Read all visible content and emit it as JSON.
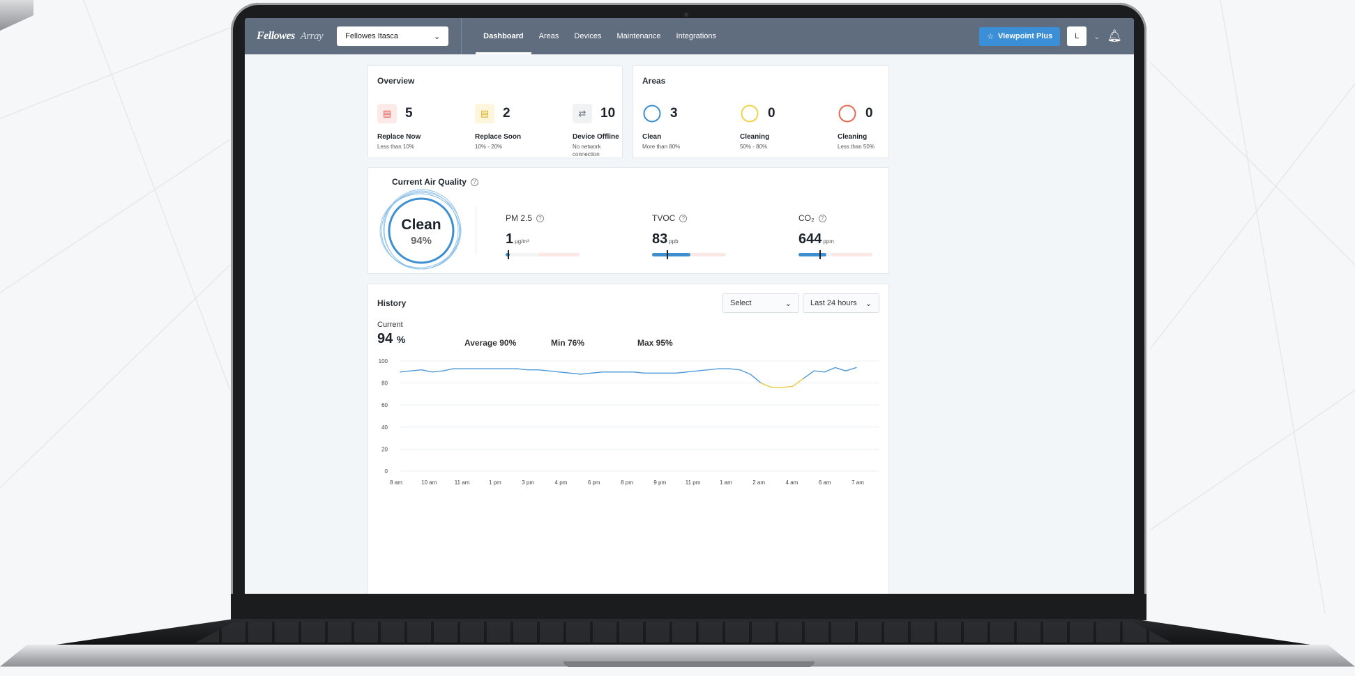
{
  "header": {
    "logo": "Fellowes",
    "logo_sub": "Array",
    "site": "Fellowes Itasca",
    "nav": [
      "Dashboard",
      "Areas",
      "Devices",
      "Maintenance",
      "Integrations"
    ],
    "viewpoint_label": "Viewpoint Plus",
    "avatar_initial": "L"
  },
  "overview": {
    "title": "Overview",
    "items": [
      {
        "value": "5",
        "label": "Replace Now",
        "sub": "Less than 10%"
      },
      {
        "value": "2",
        "label": "Replace Soon",
        "sub": "10% - 20%"
      },
      {
        "value": "10",
        "label": "Device Offline",
        "sub": "No network connection"
      }
    ]
  },
  "areas": {
    "title": "Areas",
    "items": [
      {
        "value": "3",
        "label": "Clean",
        "sub": "More than 80%",
        "color": "#3d8fd0"
      },
      {
        "value": "0",
        "label": "Cleaning",
        "sub": "50% - 80%",
        "color": "#f1d34a"
      },
      {
        "value": "0",
        "label": "Cleaning",
        "sub": "Less than 50%",
        "color": "#e86a50"
      }
    ]
  },
  "air_quality": {
    "title": "Current Air Quality",
    "status": "Clean",
    "percent": "94%",
    "metrics": [
      {
        "label": "PM 2.5",
        "value": "1",
        "unit": "µg/m³",
        "level": 0.06,
        "marker": 0.03
      },
      {
        "label": "TVOC",
        "value": "83",
        "unit": "ppb",
        "level": 0.52,
        "marker": 0.2
      },
      {
        "label": "CO₂",
        "value": "644",
        "unit": "ppm",
        "level": 0.38,
        "marker": 0.28
      }
    ]
  },
  "history": {
    "title": "History",
    "select_placeholder": "Select",
    "range": "Last 24 hours",
    "current_label": "Current",
    "current_value": "94",
    "current_unit": "%",
    "average": "Average 90%",
    "min": "Min 76%",
    "max": "Max 95%"
  },
  "chart_data": {
    "type": "line",
    "ylim": [
      0,
      100
    ],
    "yticks": [
      "0",
      "20",
      "40",
      "60",
      "80",
      "100"
    ],
    "x": [
      "8 am",
      "10 am",
      "11 am",
      "1 pm",
      "3 pm",
      "4 pm",
      "6 pm",
      "8 pm",
      "9 pm",
      "11 pm",
      "1 am",
      "2 am",
      "4 am",
      "6 am",
      "7 am"
    ],
    "series": [
      {
        "values": [
          90,
          91,
          92,
          90,
          91,
          93,
          93,
          93,
          93,
          93,
          93,
          93,
          92,
          92,
          91,
          90,
          89,
          88,
          89,
          90,
          90,
          90,
          90,
          89,
          89,
          89,
          89,
          90,
          91,
          92,
          93,
          93,
          92,
          88,
          80,
          76,
          76,
          77,
          84,
          91,
          90,
          94,
          91,
          94
        ],
        "color": "#4f9ad8",
        "low_color": "#e9c83a"
      }
    ]
  }
}
